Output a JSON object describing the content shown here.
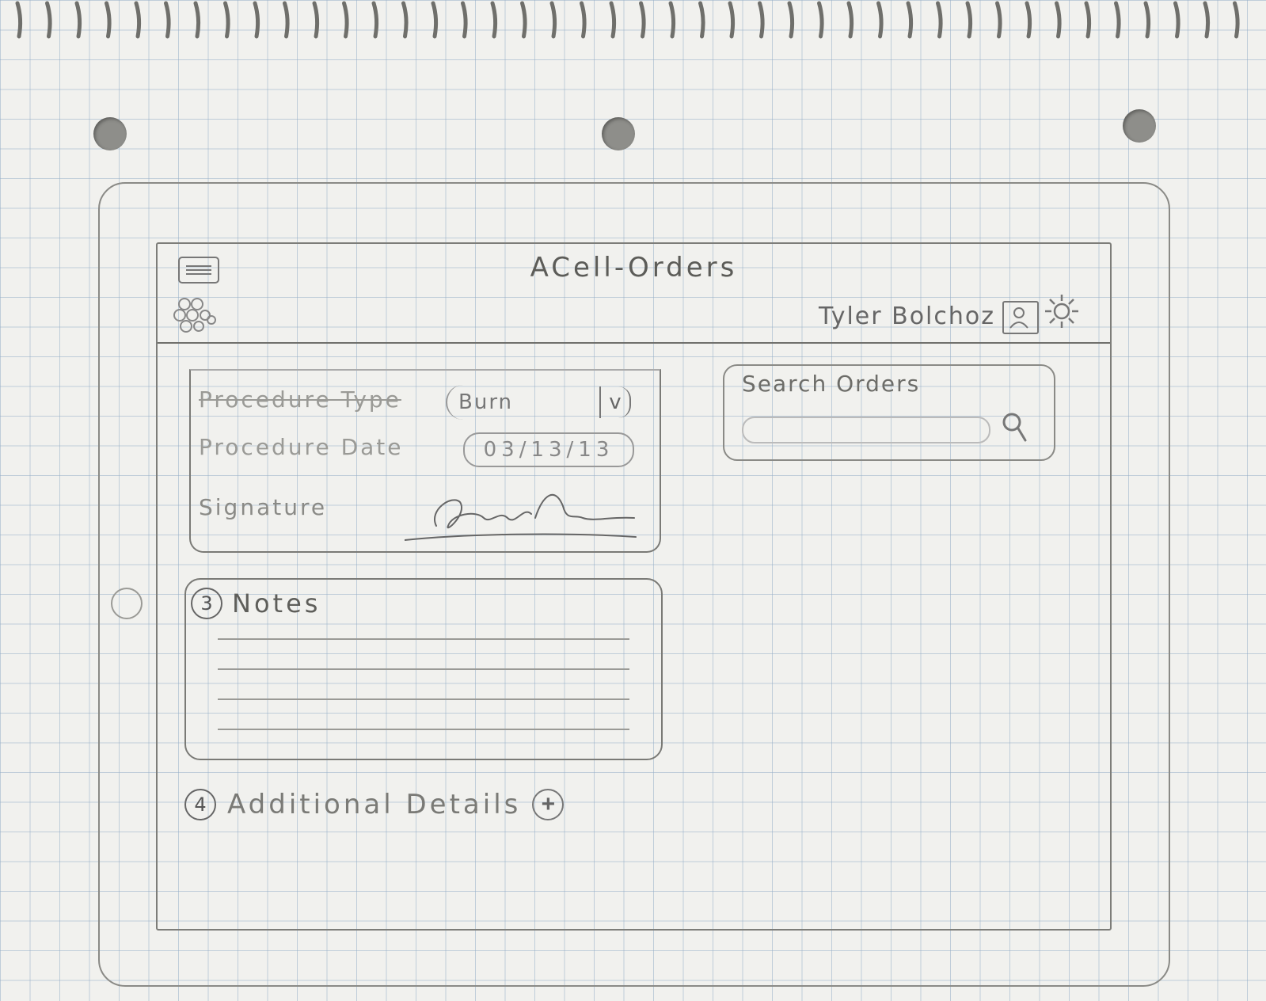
{
  "header": {
    "app_title": "ACell-Orders",
    "user_name": "Tyler Bolchoz"
  },
  "order_form": {
    "procedure_type_label": "Procedure Type",
    "procedure_type_value": "Burn",
    "procedure_date_label": "Procedure Date",
    "procedure_date_value": "03/13/13",
    "signature_label": "Signature"
  },
  "search": {
    "label": "Search Orders",
    "value": ""
  },
  "notes": {
    "step": "3",
    "title": "Notes"
  },
  "additional_details": {
    "step": "4",
    "title": "Additional Details",
    "add_symbol": "+"
  },
  "icons": [
    "menu-icon",
    "app-icon",
    "avatar-icon",
    "gear-icon",
    "chevron-down-icon",
    "search-icon",
    "plus-icon"
  ]
}
